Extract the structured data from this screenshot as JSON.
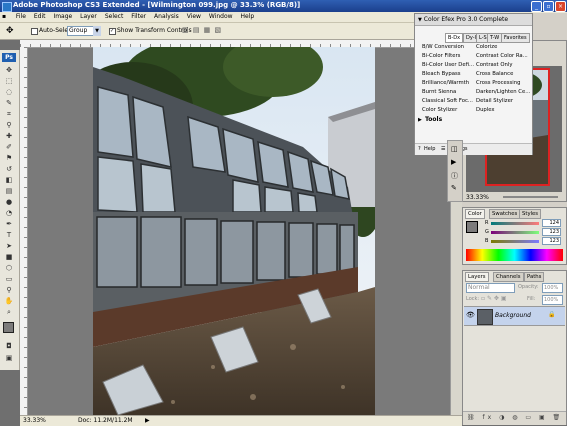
{
  "window": {
    "title": "Adobe Photoshop CS3 Extended - [Wilmington 099.jpg @ 33.3% (RGB/8)]",
    "controls": [
      "_",
      "▫",
      "×"
    ]
  },
  "menu": [
    "File",
    "Edit",
    "Image",
    "Layer",
    "Select",
    "Filter",
    "Analysis",
    "View",
    "Window",
    "Help"
  ],
  "options_bar": {
    "auto_select_label": "Auto-Select:",
    "auto_select_value": "Group",
    "show_transform_label": "Show Transform Controls"
  },
  "toolbox": {
    "logo": "Ps"
  },
  "efex_panel": {
    "title": "Color Efex Pro 3.0 Complete",
    "tabs": [
      "B-Dx",
      "Dy-I",
      "L-S",
      "T-W",
      "Favorites"
    ],
    "filters_left": [
      "B/W Conversion",
      "Bi-Color Filters",
      "Bi-Color User Defi...",
      "Bleach Bypass",
      "Brilliance/Warmth",
      "Burnt Sienna",
      "Classical Soft Foc...",
      "Color Stylizer"
    ],
    "filters_right": [
      "Colorize",
      "Contrast Color Ra...",
      "Contrast Only",
      "Cross Balance",
      "Cross Processing",
      "Darken/Lighten Ce...",
      "Detail Stylizer",
      "Duplex"
    ],
    "tools_label": "Tools",
    "help_label": "Help",
    "settings_label": "Settings"
  },
  "navigator": {
    "zoom": "33.33%"
  },
  "color_panel": {
    "tabs": [
      "Color",
      "Swatches",
      "Styles"
    ],
    "channels": [
      {
        "label": "R",
        "value": "124"
      },
      {
        "label": "G",
        "value": "123"
      },
      {
        "label": "B",
        "value": "123"
      }
    ]
  },
  "layers_panel": {
    "tabs": [
      "Layers",
      "Channels",
      "Paths"
    ],
    "blend_mode": "Normal",
    "opacity_label": "Opacity:",
    "opacity_value": "100%",
    "lock_label": "Lock:",
    "fill_label": "Fill:",
    "fill_value": "100%",
    "layer_name": "Background"
  },
  "status_bar": {
    "zoom": "33.33%",
    "doc_info": "Doc: 11.2M/11.2M"
  }
}
